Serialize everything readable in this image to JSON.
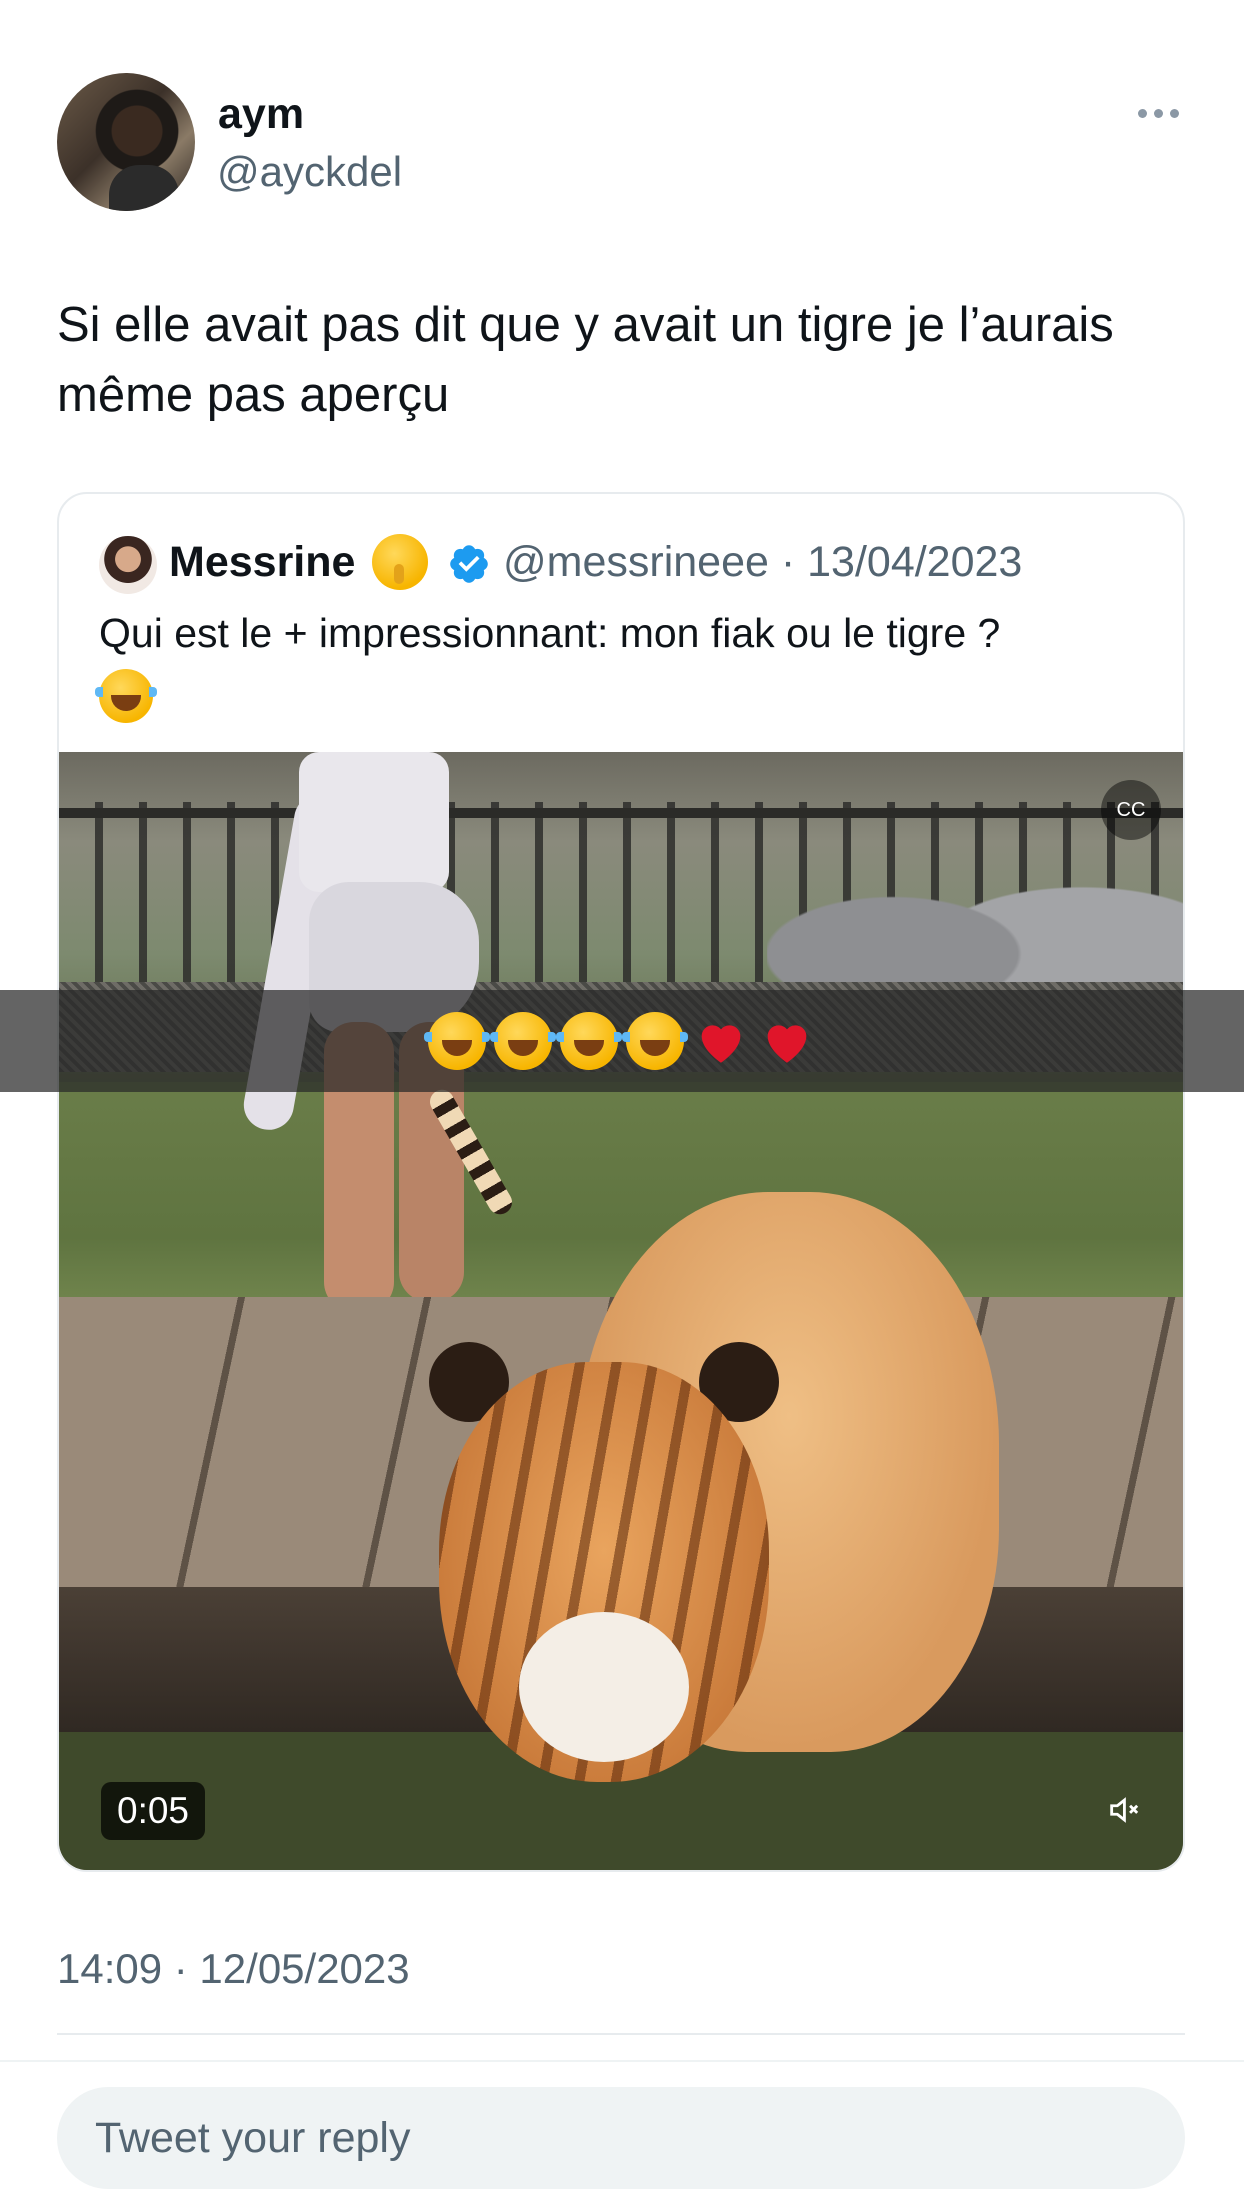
{
  "author": {
    "display_name": "aym",
    "handle": "@ayckdel"
  },
  "tweet": {
    "text": "Si elle avait pas dit que y avait un tigre je l’aurais même pas aperçu",
    "timestamp": "14:09 · 12/05/2023"
  },
  "quoted": {
    "display_name": "Messrine",
    "handle_date": "@messrineee · 13/04/2023",
    "text": "Qui est le + impressionnant: mon fiak ou le tigre ?",
    "video": {
      "duration": "0:05",
      "caption_emojis": [
        "face-with-tears-of-joy",
        "face-with-tears-of-joy",
        "face-with-tears-of-joy",
        "face-with-tears-of-joy",
        "red-heart",
        "red-heart"
      ]
    }
  },
  "reply": {
    "placeholder": "Tweet your reply"
  },
  "colors": {
    "text_primary": "#0f1419",
    "text_secondary": "#536471",
    "verified_blue": "#1d9bf0",
    "heart_red": "#e0152a"
  }
}
